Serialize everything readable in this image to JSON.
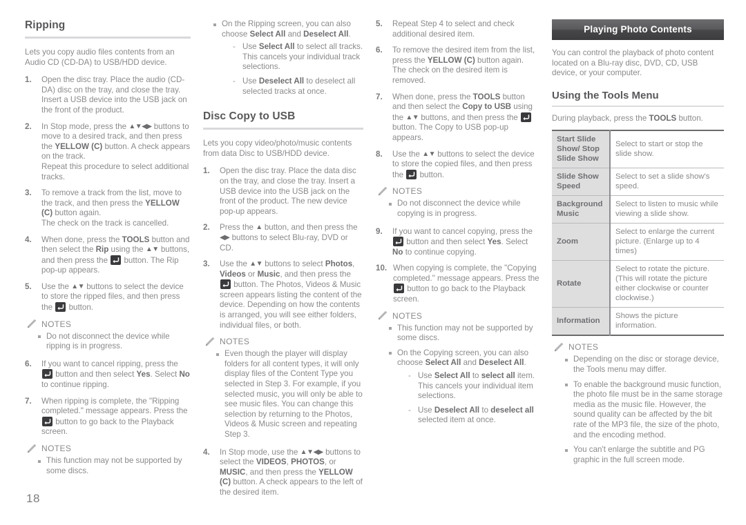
{
  "page_number": "18",
  "icons": {
    "enter_button": "enter-key-icon",
    "notes_pencil": "pencil-icon",
    "up_down": "▲▼",
    "up_down_left_right": "▲▼◀▶",
    "left_right": "◀▶",
    "up": "▲"
  },
  "column1": {
    "heading": "Ripping",
    "intro": "Lets you copy audio files contents from an Audio CD (CD-DA) to USB/HDD device.",
    "steps": [
      {
        "num": "1.",
        "text": "Open the disc tray. Place the audio (CD-DA) disc on the tray, and close the tray. Insert a USB device into the USB jack on the front of the product."
      },
      {
        "num": "2.",
        "text": "In Stop mode, press the ▲▼◀▶ buttons to move to a desired track, and then press the YELLOW (C) button. A check appears on the track. Repeat this procedure to select additional tracks."
      },
      {
        "num": "3.",
        "text": "To remove a track from the list, move to the track, and then press the YELLOW (C) button again. The check on the track is cancelled."
      },
      {
        "num": "4.",
        "text": "When done, press the TOOLS button and then select the Rip using the ▲▼ buttons, and then press the ⏎ button. The Rip pop-up appears."
      },
      {
        "num": "5.",
        "text": "Use the ▲▼ buttons to select the device to store the ripped files, and then press the ⏎ button."
      }
    ],
    "notes_label": "NOTES",
    "notes1": [
      "Do not disconnect the device while ripping is in progress."
    ],
    "steps2": [
      {
        "num": "6.",
        "text": "If you want to cancel ripping, press the ⏎ button and then select Yes. Select No to continue ripping."
      },
      {
        "num": "7.",
        "text": "When ripping is complete, the \"Ripping completed.\" message appears. Press the ⏎ button to go back to the Playback screen."
      }
    ],
    "notes2": [
      "This function may not be supported by some discs."
    ]
  },
  "column2": {
    "notes_label": "NOTES",
    "top_note": "On the Ripping screen, you can also choose Select All and Deselect All.",
    "top_dashes": [
      "Use Select All to select all tracks. This cancels your individual track selections.",
      "Use Deselect All to deselect all selected tracks at once."
    ],
    "heading": "Disc Copy to USB",
    "intro": "Lets you copy video/photo/music contents from data Disc to USB/HDD device.",
    "steps": [
      {
        "num": "1.",
        "text": "Open the disc tray. Place the data disc on the tray, and close the tray. Insert a USB device into the USB jack on the front of the product. The new device pop-up appears."
      },
      {
        "num": "2.",
        "text": "Press the ▲ button, and then press the ◀▶ buttons to select Blu-ray, DVD or CD."
      },
      {
        "num": "3.",
        "text": "Use the ▲▼ buttons to select Photos, Videos or Music, and then press the ⏎ button. The Photos, Videos & Music screen appears listing the content of the device. Depending on how the contents is arranged, you will see either folders, individual files, or both."
      }
    ],
    "notes": [
      "Even though the player will display folders for all content types, it will only display files of the Content Type you selected in Step 3. For example, if you selected music, you will only be able to see music files. You can change this selection by returning to the Photos, Videos & Music screen and repeating Step 3."
    ],
    "steps2": [
      {
        "num": "4.",
        "text": "In Stop mode, use the ▲▼◀▶ buttons to select the VIDEOS, PHOTOS, or MUSIC, and then press the YELLOW (C) button. A check appears to the left of the desired item."
      }
    ]
  },
  "column3": {
    "notes_label": "NOTES",
    "steps": [
      {
        "num": "5.",
        "text": "Repeat Step 4 to select and check additional desired item."
      },
      {
        "num": "6.",
        "text": "To remove the desired item from the list, press the YELLOW (C) button again. The check on the desired item is removed."
      },
      {
        "num": "7.",
        "text": "When done, press the TOOLS button and then select the Copy to USB using the ▲▼ buttons, and then press the ⏎ button. The Copy to USB pop-up appears."
      },
      {
        "num": "8.",
        "text": "Use the ▲▼ buttons to select the device to store the copied files, and then press the ⏎ button."
      }
    ],
    "notes1": [
      "Do not disconnect the device while copying is in progress."
    ],
    "steps2": [
      {
        "num": "9.",
        "text": "If you want to cancel copying, press the ⏎ button and then select Yes. Select No to continue copying."
      },
      {
        "num": "10.",
        "text": "When copying is complete, the \"Copying completed.\" message appears. Press the ⏎ button to go back to the Playback screen."
      }
    ],
    "notes2": [
      "This function may not be supported by some discs.",
      "On the Copying screen, you can also choose Select All and Deselect All."
    ],
    "dashes": [
      "Use Select All to select all item. This cancels your individual item selections.",
      "Use Deselect All to deselect all selected item at once."
    ]
  },
  "column4": {
    "bar_title": "Playing Photo Contents",
    "intro": "You can control the playback of photo content located on a Blu-ray disc, DVD, CD, USB device, or your computer.",
    "sub_heading": "Using the Tools Menu",
    "sub_intro": "During playback, press the TOOLS button.",
    "table": {
      "rows": [
        {
          "key": "Start Slide Show/ Stop Slide Show",
          "value": "Select to start or stop the slide show."
        },
        {
          "key": "Slide Show Speed",
          "value": "Select to set a slide show's speed."
        },
        {
          "key": "Background Music",
          "value": "Select to listen to music while viewing a slide show."
        },
        {
          "key": "Zoom",
          "value": "Select to enlarge the current picture. (Enlarge up to 4 times)"
        },
        {
          "key": "Rotate",
          "value": "Select to rotate the picture. (This will rotate the picture either clockwise or counter clockwise.)"
        },
        {
          "key": "Information",
          "value": "Shows the picture information."
        }
      ]
    },
    "notes_label": "NOTES",
    "notes": [
      "Depending on the disc or storage device, the Tools menu may differ.",
      "To enable the background music function, the photo file must be in the same storage media as the music file. However, the sound quality can be affected by the bit rate of the MP3 file, the size of the photo, and the encoding method.",
      "You can't enlarge the subtitle and PG graphic in the full screen mode."
    ]
  },
  "colors": {
    "bar_dark": "#47474a",
    "body_text": "#8a8a8d",
    "heading": "#58585b",
    "table_key_bg": "#dededf",
    "rule": "#d9d9dc"
  }
}
